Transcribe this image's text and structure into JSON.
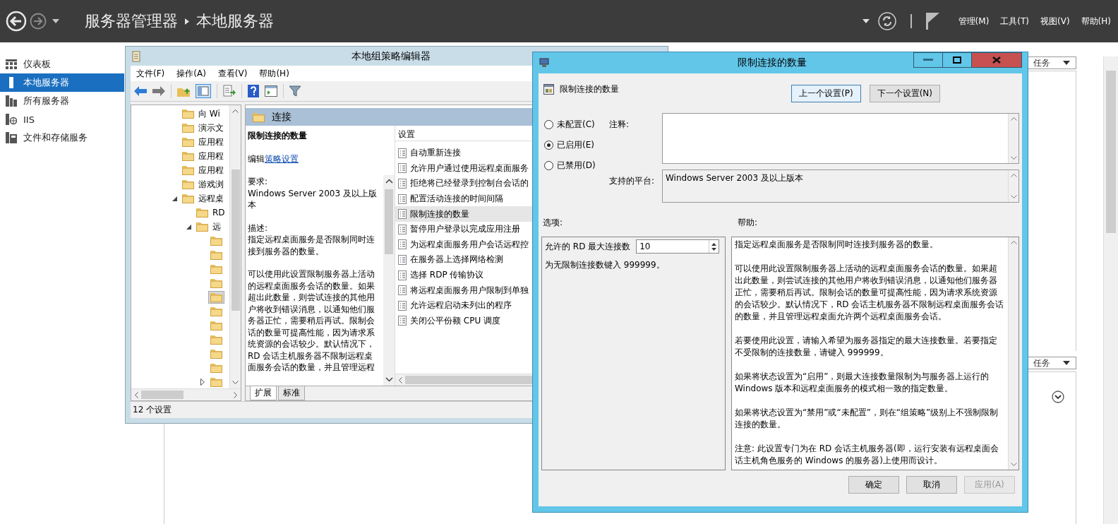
{
  "top_bar": {
    "breadcrumb": [
      "服务器管理器",
      "本地服务器"
    ],
    "menu": [
      "管理(M)",
      "工具(T)",
      "视图(V)",
      "帮助(H)"
    ]
  },
  "sidebar": {
    "items": [
      {
        "label": "仪表板",
        "kind": "dashboard",
        "selected": false
      },
      {
        "label": "本地服务器",
        "kind": "server",
        "selected": true
      },
      {
        "label": "所有服务器",
        "kind": "servers",
        "selected": false
      },
      {
        "label": "IIS",
        "kind": "iis",
        "selected": false
      },
      {
        "label": "文件和存储服务",
        "kind": "storage",
        "selected": false
      }
    ]
  },
  "background_panel": {
    "task_buttons": [
      "任务",
      "任务"
    ]
  },
  "gpedit": {
    "title": "本地组策略编辑器",
    "menu": [
      "文件(F)",
      "操作(A)",
      "查看(V)",
      "帮助(H)"
    ],
    "tree": [
      {
        "label": "向 Wi",
        "selected": false
      },
      {
        "label": "演示文",
        "selected": false
      },
      {
        "label": "应用程",
        "selected": false
      },
      {
        "label": "应用程",
        "selected": false
      },
      {
        "label": "应用程",
        "selected": false
      },
      {
        "label": "游戏浏",
        "selected": false
      },
      {
        "label": "远程桌",
        "selected": false,
        "expanded": true,
        "children": [
          {
            "label": "RD",
            "selected": false
          },
          {
            "label": "远",
            "selected": false,
            "expanded": true,
            "children": [
              {
                "selected": false
              },
              {
                "selected": false
              },
              {
                "selected": false
              },
              {
                "selected": false
              },
              {
                "selected": true
              },
              {
                "selected": false
              },
              {
                "selected": false
              },
              {
                "selected": false
              },
              {
                "selected": false
              },
              {
                "selected": false
              },
              {
                "selected": false,
                "expanded": false
              }
            ]
          }
        ]
      }
    ],
    "header": "连接",
    "details": {
      "title": "限制连接的数量",
      "edit_prefix": "编辑",
      "edit_link": "策略设置",
      "requirement_label": "要求:",
      "requirement": "Windows Server 2003 及以上版本",
      "description_label": "描述:",
      "description": [
        "指定远程桌面服务是否限制同时连接到服务器的数量。",
        "可以使用此设置限制服务器上活动的远程桌面服务会话的数量。如果超出此数量，则尝试连接的其他用户将收到错误消息，以通知他们服务器正忙，需要稍后再试。限制会话的数量可提高性能，因为请求系统资源的会话较少。默认情况下，RD 会话主机服务器不限制远程桌面服务会话的数量，并且管理远程"
      ]
    },
    "settings": {
      "header": "设置",
      "items": [
        {
          "label": "自动重新连接",
          "selected": false
        },
        {
          "label": "允许用户通过使用远程桌面服务",
          "selected": false
        },
        {
          "label": "拒绝将已经登录到控制台会话的",
          "selected": false
        },
        {
          "label": "配置活动连接的时间间隔",
          "selected": false
        },
        {
          "label": "限制连接的数量",
          "selected": true
        },
        {
          "label": "暂停用户登录以完成应用注册",
          "selected": false
        },
        {
          "label": "为远程桌面服务用户会话远程控",
          "selected": false
        },
        {
          "label": "在服务器上选择网络检测",
          "selected": false
        },
        {
          "label": "选择 RDP 传输协议",
          "selected": false
        },
        {
          "label": "将远程桌面服务用户限制到单独",
          "selected": false
        },
        {
          "label": "允许远程启动未列出的程序",
          "selected": false
        },
        {
          "label": "关闭公平份额 CPU 调度",
          "selected": false
        }
      ]
    },
    "tabs": [
      {
        "label": "扩展",
        "selected": true
      },
      {
        "label": "标准",
        "selected": false
      }
    ],
    "status_bar": "12 个设置"
  },
  "dialog": {
    "title": "限制连接的数量",
    "heading": "限制连接的数量",
    "nav_buttons": [
      "上一个设置(P)",
      "下一个设置(N)"
    ],
    "states": [
      {
        "label": "未配置(C)",
        "selected": false
      },
      {
        "label": "已启用(E)",
        "selected": true
      },
      {
        "label": "已禁用(D)",
        "selected": false
      }
    ],
    "comment_label": "注释:",
    "platform_label": "支持的平台:",
    "platform": "Windows Server 2003 及以上版本",
    "options_label": "选项:",
    "help_label": "帮助:",
    "options": {
      "field_label": "允许的 RD 最大连接数",
      "value": "10",
      "hint": "为无限制连接数键入 999999。"
    },
    "help": [
      "指定远程桌面服务是否限制同时连接到服务器的数量。",
      "可以使用此设置限制服务器上活动的远程桌面服务会话的数量。如果超出此数量，则尝试连接的其他用户将收到错误消息，以通知他们服务器正忙，需要稍后再试。限制会话的数量可提高性能，因为请求系统资源的会话较少。默认情况下，RD 会话主机服务器不限制远程桌面服务会话的数量，并且管理远程桌面允许两个远程桌面服务会话。",
      "若要使用此设置，请输入希望为服务器指定的最大连接数量。若要指定不受限制的连接数量，请键入 999999。",
      "如果将状态设置为“启用”，则最大连接数量限制为与服务器上运行的 Windows 版本和远程桌面服务的模式相一致的指定数量。",
      "如果将状态设置为“禁用”或“未配置”，则在“组策略”级别上不强制限制连接的数量。",
      "注意: 此设置专门为在 RD 会话主机服务器(即，运行安装有远程桌面会话主机角色服务的 Windows 的服务器)上使用而设计。"
    ],
    "buttons": [
      {
        "label": "确定",
        "disabled": false
      },
      {
        "label": "取消",
        "disabled": false
      },
      {
        "label": "应用(A)",
        "disabled": true
      }
    ]
  }
}
